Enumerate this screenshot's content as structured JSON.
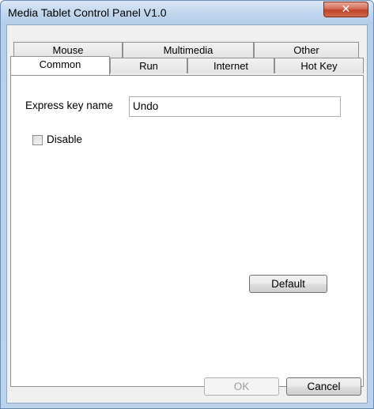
{
  "window": {
    "title": "Media Tablet Control Panel V1.0"
  },
  "tabs": {
    "row_back": [
      {
        "label": "Mouse"
      },
      {
        "label": "Multimedia"
      },
      {
        "label": "Other"
      }
    ],
    "row_front": [
      {
        "label": "Common",
        "selected": true
      },
      {
        "label": "Run"
      },
      {
        "label": "Internet"
      },
      {
        "label": "Hot Key"
      }
    ]
  },
  "common": {
    "express_key_label": "Express key name",
    "express_key_value": "Undo",
    "disable_label": "Disable",
    "disable_checked": false,
    "default_label": "Default"
  },
  "footer": {
    "ok_label": "OK",
    "ok_enabled": false,
    "cancel_label": "Cancel"
  }
}
